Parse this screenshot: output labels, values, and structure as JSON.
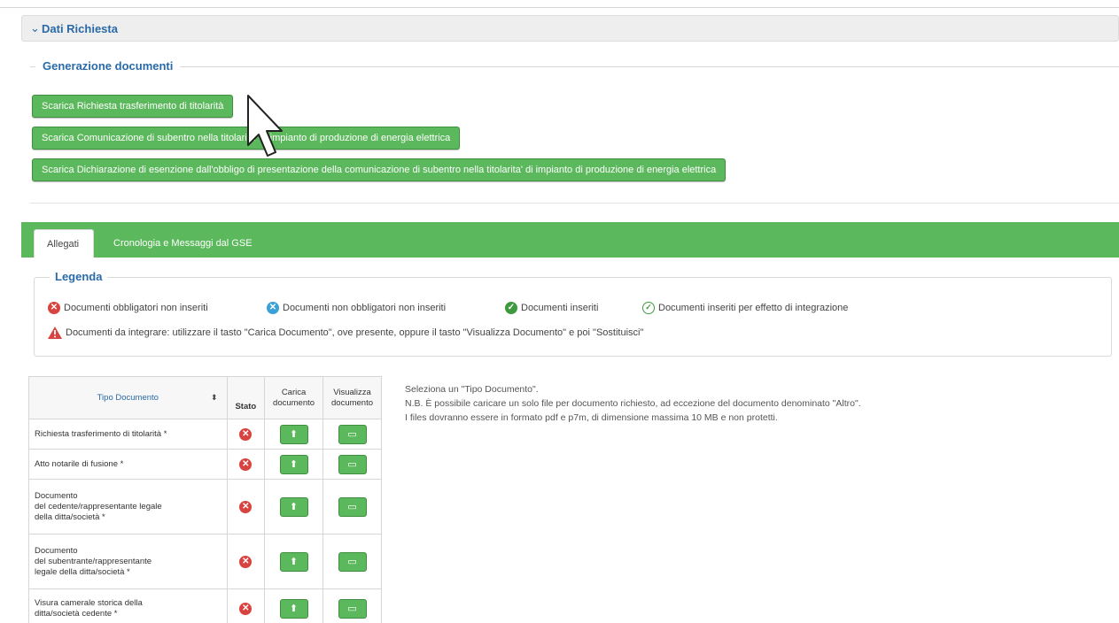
{
  "section": {
    "title": "Dati Richiesta"
  },
  "generazione": {
    "legend": "Generazione documenti",
    "buttons": [
      "Scarica Richiesta trasferimento di titolarità",
      "Scarica Comunicazione di subentro nella titolarita' di impianto di produzione di energia elettrica",
      "Scarica Dichiarazione di esenzione dall'obbligo di presentazione della comunicazione di subentro nella titolarita' di impianto di produzione di energia elettrica"
    ]
  },
  "tabs": {
    "allegati": "Allegati",
    "cronologia": "Cronologia e Messaggi dal GSE"
  },
  "legenda": {
    "title": "Legenda",
    "item1": "Documenti obbligatori non inseriti",
    "item2": "Documenti non obbligatori non inseriti",
    "item3": "Documenti inseriti",
    "item4": "Documenti inseriti per effetto di integrazione",
    "item5": "Documenti da integrare: utilizzare il tasto \"Carica Documento\", ove presente, oppure il tasto \"Visualizza Documento\" e poi \"Sostituisci\""
  },
  "table": {
    "headers": {
      "tipo": "Tipo Documento",
      "stato": "Stato",
      "carica_1": "Carica",
      "carica_2": "documento",
      "visualizza_1": "Visualizza",
      "visualizza_2": "documento"
    },
    "rows": [
      [
        "Richiesta trasferimento di titolarità *"
      ],
      [
        "Atto notarile di fusione *"
      ],
      [
        "Documento",
        "del cedente/rappresentante legale",
        "della ditta/società *"
      ],
      [
        "Documento",
        "del subentrante/rappresentante",
        "legale della ditta/società *"
      ],
      [
        "Visura camerale storica della",
        "ditta/società cedente *"
      ]
    ]
  },
  "help": {
    "line1": "Seleziona un \"Tipo Documento\".",
    "line2": "N.B. È possibile caricare un solo file per documento richiesto, ad eccezione del documento denominato \"Altro\".",
    "line3": "I files dovranno essere in formato pdf e p7m, di dimensione massima 10 MB e non protetti."
  },
  "colors": {
    "green": "#5cb85c",
    "blue_title": "#2a6aa8",
    "red": "#d9433f",
    "info_blue": "#3aa0d8"
  }
}
